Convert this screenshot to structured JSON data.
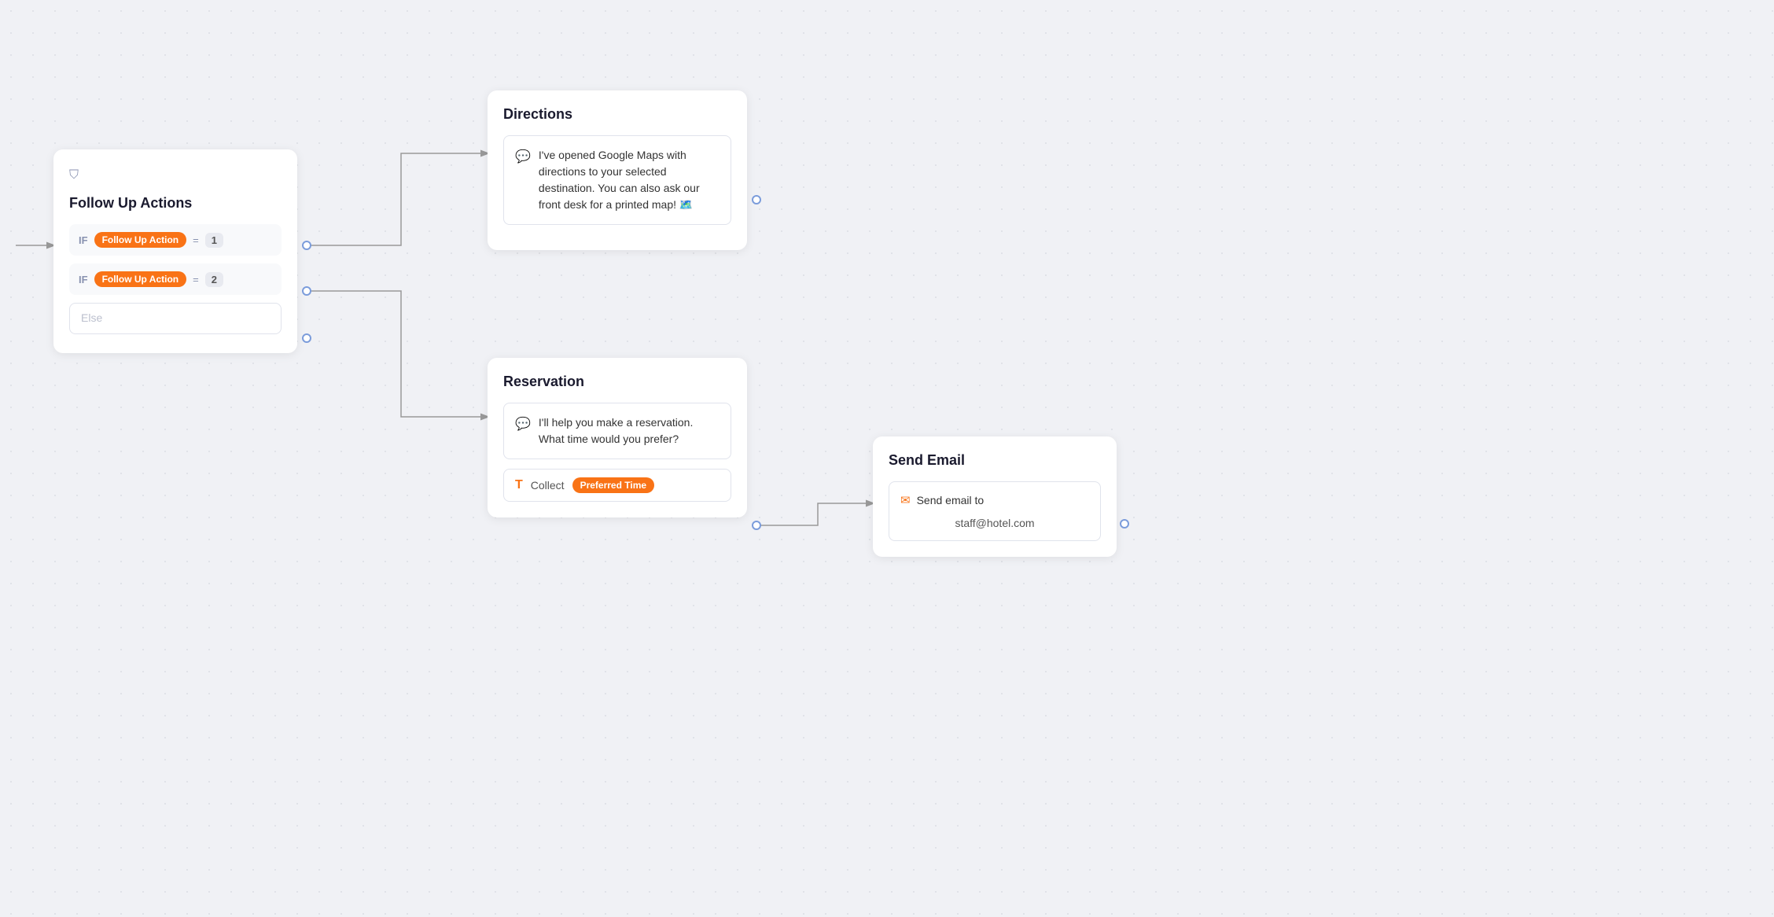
{
  "followUpActions": {
    "title": "Follow Up Actions",
    "condition1": {
      "if": "IF",
      "badge": "Follow Up Action",
      "equals": "=",
      "value": "1"
    },
    "condition2": {
      "if": "IF",
      "badge": "Follow Up Action",
      "equals": "=",
      "value": "2"
    },
    "else": "Else"
  },
  "directions": {
    "title": "Directions",
    "message": "I've opened Google Maps with directions to your selected destination. You can also ask our front desk for a printed map! 🗺️"
  },
  "reservation": {
    "title": "Reservation",
    "message": "I'll help you make a reservation. What time would you prefer?",
    "collectLabel": "Collect",
    "collectBadge": "Preferred Time"
  },
  "sendEmail": {
    "title": "Send Email",
    "sendLabel": "Send email to",
    "email": "staff@hotel.com"
  }
}
